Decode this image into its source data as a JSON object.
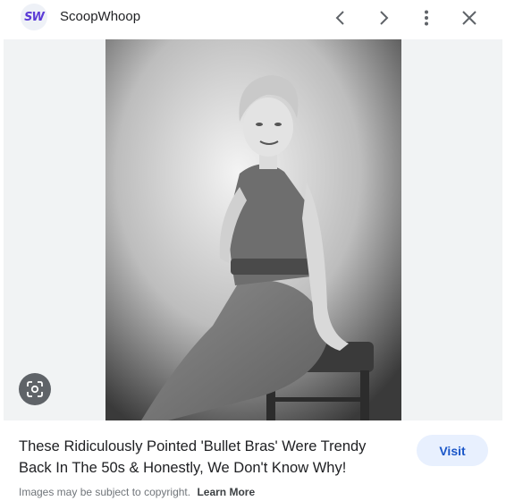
{
  "header": {
    "logo_text": "SW",
    "site_name": "ScoopWhoop",
    "icons": [
      "chevron-left-icon",
      "chevron-right-icon",
      "more-vert-icon",
      "close-icon"
    ]
  },
  "image": {
    "lens_icon": "lens-icon"
  },
  "result": {
    "title_line1": "These Ridiculously Pointed 'Bullet Bras' Were Trendy",
    "title_line2": "Back In The 50s & Honestly, We Don't Know Why!",
    "visit_label": "Visit",
    "copyright_text": "Images may be subject to copyright.",
    "learn_more_label": "Learn More"
  },
  "colors": {
    "accent": "#1a56c8",
    "visit_bg": "#e8f0fe",
    "logo": "#5b3bd6"
  }
}
